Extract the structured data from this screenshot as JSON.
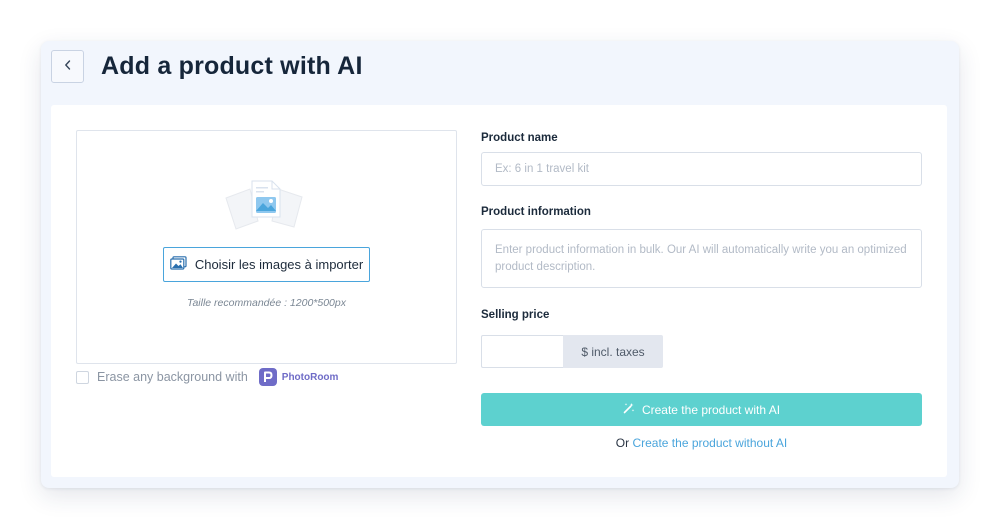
{
  "header": {
    "title": "Add a product with AI",
    "back_icon": "chevron-left-icon"
  },
  "upload": {
    "button_label": "Choisir les images à importer",
    "hint": "Taille recommandée : 1200*500px",
    "erase_label": "Erase any background with",
    "photoroom_label": "PhotoRoom",
    "erase_checked": false
  },
  "form": {
    "name_label": "Product name",
    "name_placeholder": "Ex: 6 in 1 travel kit",
    "name_value": "",
    "info_label": "Product information",
    "info_placeholder": "Enter product information in bulk. Our AI will automatically write you an optimized product description.",
    "info_value": "",
    "price_label": "Selling price",
    "price_value": "",
    "price_suffix": "$ incl. taxes",
    "ai_button_label": "Create the product with AI",
    "or_text": "Or",
    "no_ai_link": "Create the product without AI"
  },
  "colors": {
    "accent_teal": "#5dd1cf",
    "link_blue": "#4aa5dc",
    "card_bg": "#f2f6fd",
    "photoroom_purple": "#6f6cc7"
  }
}
